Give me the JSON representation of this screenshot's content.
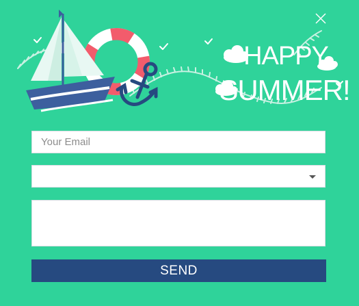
{
  "hero": {
    "headline_line1": "HAPPY",
    "headline_line2": "SUMMER!",
    "illustration_icons": [
      "sailboat-icon",
      "life-ring-icon",
      "anchor-icon",
      "cloud-icon",
      "bird-icon",
      "rope-icon"
    ]
  },
  "form": {
    "email_placeholder": "Your Email",
    "select_value": "",
    "message_placeholder": "",
    "send_label": "SEND"
  },
  "colors": {
    "background": "#2fd39a",
    "button": "#264a80",
    "headline": "#ffffff",
    "sail": "#e8f8f3",
    "hull": "#3d5f9e",
    "life_ring": "#f25c6c"
  }
}
